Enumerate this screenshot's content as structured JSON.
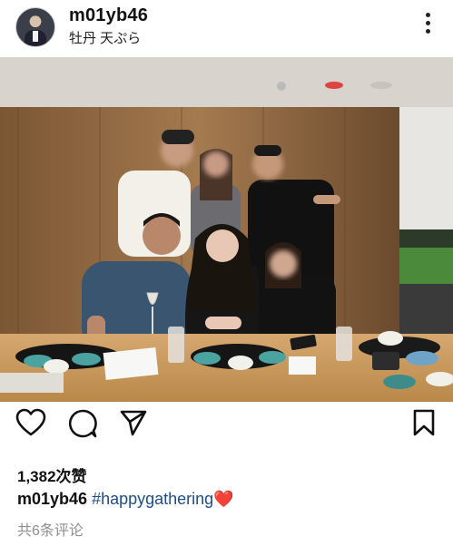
{
  "header": {
    "username": "m01yb46",
    "location": "牡丹 天ぷら"
  },
  "icons": {
    "avatar": "avatar",
    "more": "more-vertical-icon",
    "like": "heart-outline-icon",
    "comment": "comment-bubble-icon",
    "share": "send-icon",
    "save": "bookmark-icon"
  },
  "post": {
    "likes": "1,382次赞",
    "caption_user": "m01yb46",
    "caption_tag": "#happygathering",
    "caption_emoji": "❤️",
    "comments": "共6条评论"
  },
  "colors": {
    "hashtag": "#1d4e89",
    "heart": "#e0141e",
    "muted": "#8e8e8e"
  }
}
